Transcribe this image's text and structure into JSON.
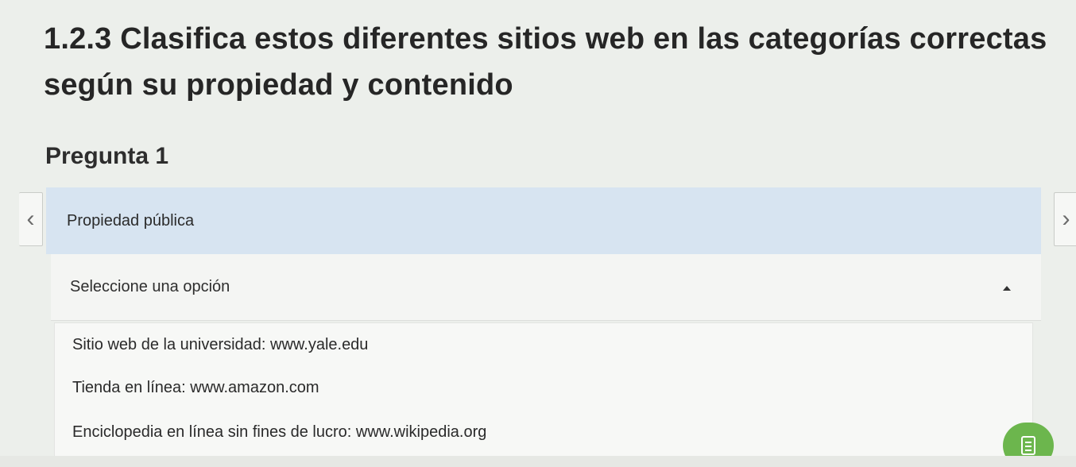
{
  "header": {
    "title": "1.2.3 Clasifica estos diferentes sitios web en las categorías correctas según su propiedad y contenido"
  },
  "question": {
    "title": "Pregunta 1",
    "category": "Propiedad pública",
    "select_placeholder": "Seleccione una opción",
    "options": [
      "Sitio web de la universidad: www.yale.edu",
      "Tienda en línea: www.amazon.com",
      "Enciclopedia en línea sin fines de lucro: www.wikipedia.org"
    ]
  },
  "navigation": {
    "prev_icon": "chevron-left-icon",
    "next_icon": "chevron-right-icon"
  },
  "icons": {
    "dropdown": "caret-up-icon",
    "notes": "notes-icon"
  },
  "colors": {
    "category_bar": "#d7e4f1",
    "notes_button": "#6cb64d",
    "background": "#ecefeb"
  }
}
